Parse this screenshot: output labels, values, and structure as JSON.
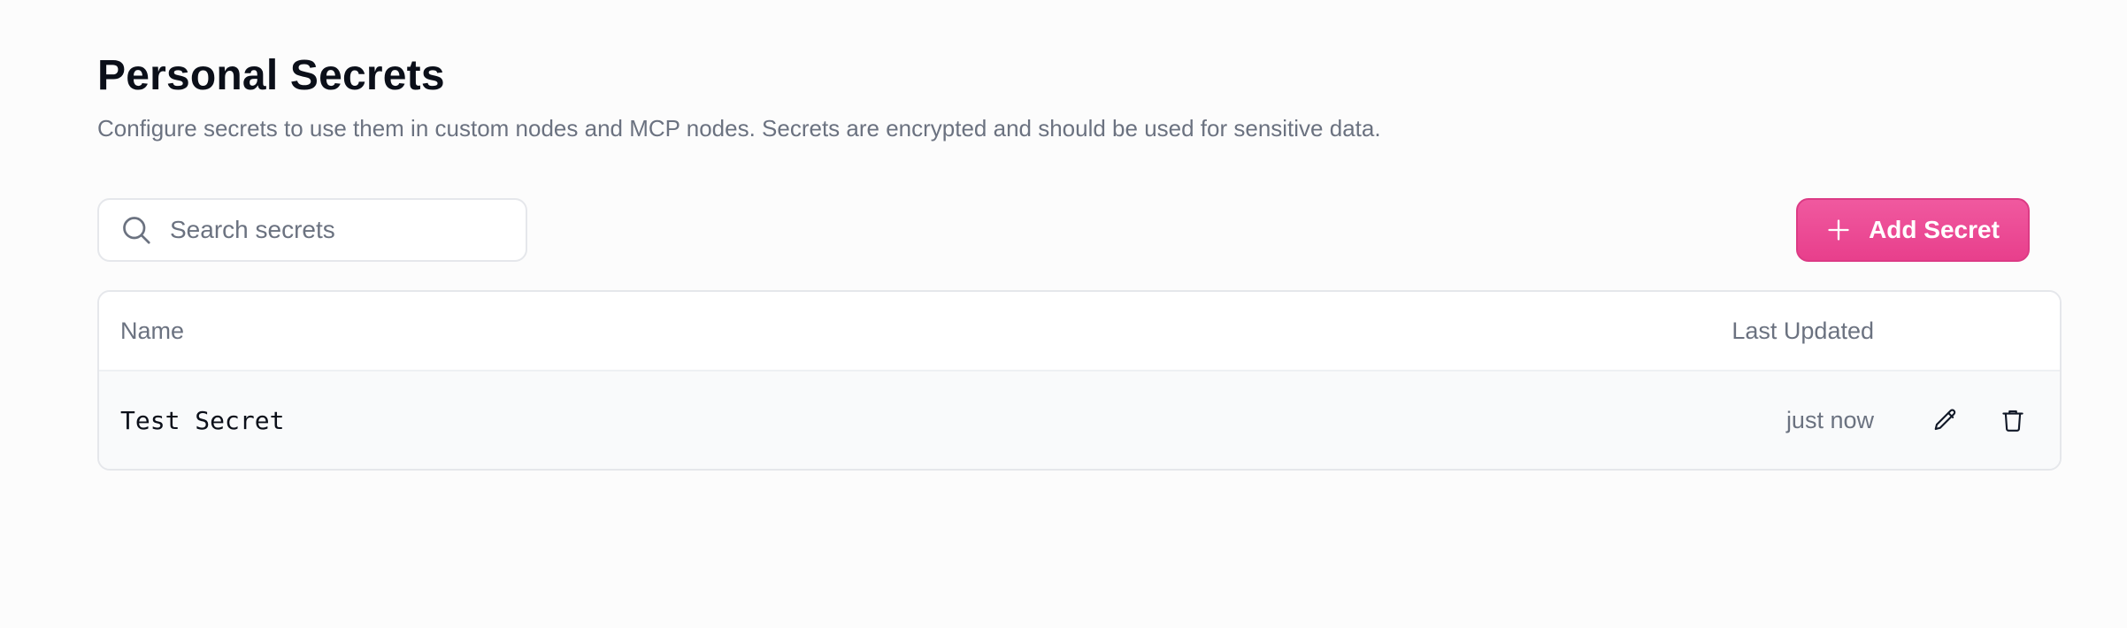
{
  "header": {
    "title": "Personal Secrets",
    "subtitle": "Configure secrets to use them in custom nodes and MCP nodes. Secrets are encrypted and should be used for sensitive data."
  },
  "search": {
    "placeholder": "Search secrets",
    "value": "",
    "icon": "search-icon"
  },
  "toolbar": {
    "add_label": "Add Secret",
    "add_icon": "plus-icon",
    "accent": "#ec4899"
  },
  "table": {
    "columns": [
      "Name",
      "Last Updated"
    ],
    "rows": [
      {
        "name": "Test Secret",
        "last_updated": "just now",
        "actions": [
          "pencil-icon",
          "trash-icon"
        ]
      }
    ]
  }
}
